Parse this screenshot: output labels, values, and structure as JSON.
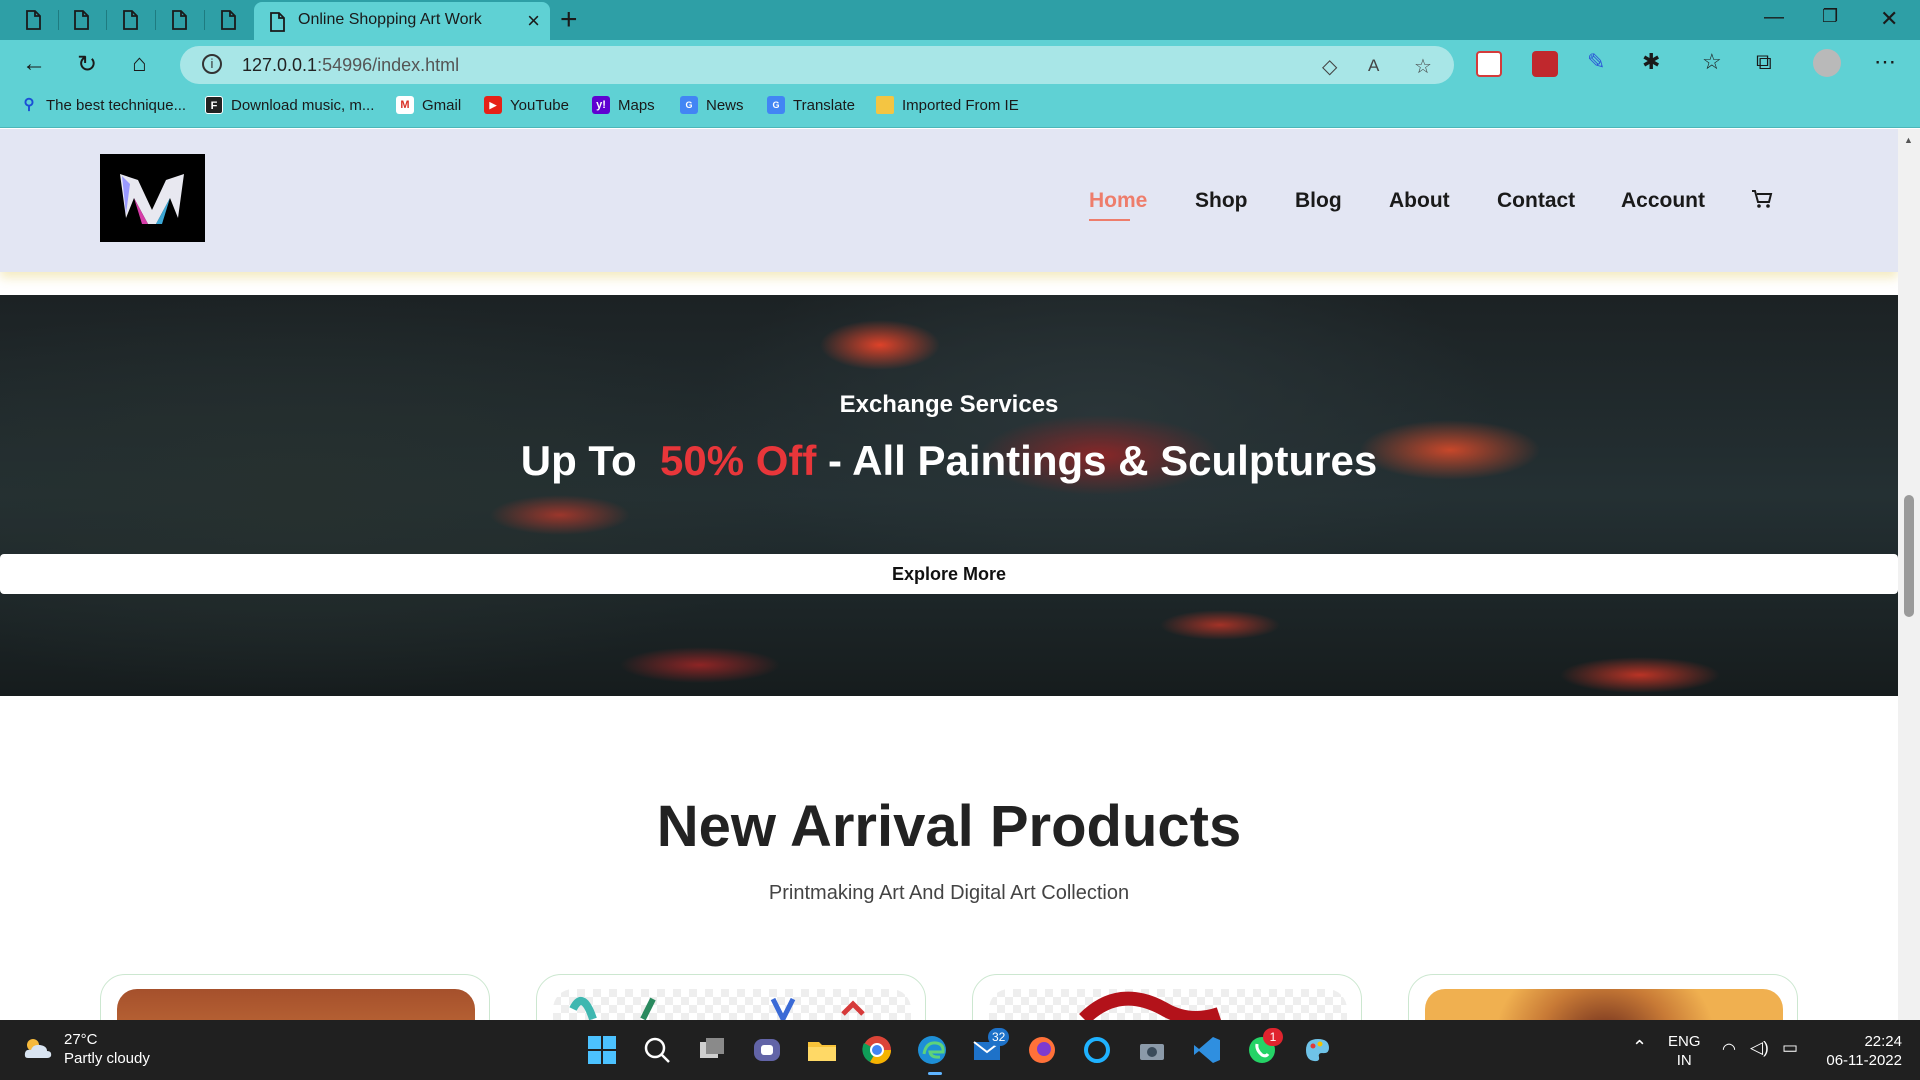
{
  "browser": {
    "active_tab_title": "Online Shopping Art Work",
    "url_host": "127.0.0.1",
    "url_rest": ":54996/index.html",
    "bookmarks": [
      {
        "label": "The best technique...",
        "icon": "search-icon"
      },
      {
        "label": "Download music, m...",
        "icon": "f-logo-icon"
      },
      {
        "label": "Gmail",
        "icon": "gmail-icon"
      },
      {
        "label": "YouTube",
        "icon": "youtube-icon"
      },
      {
        "label": "Maps",
        "icon": "yahoo-icon"
      },
      {
        "label": "News",
        "icon": "news-icon"
      },
      {
        "label": "Translate",
        "icon": "translate-icon"
      },
      {
        "label": "Imported From IE",
        "icon": "folder-icon"
      }
    ]
  },
  "site": {
    "nav": {
      "home": "Home",
      "shop": "Shop",
      "blog": "Blog",
      "about": "About",
      "contact": "Contact",
      "account": "Account"
    },
    "hero": {
      "subtitle": "Exchange Services",
      "title_prefix": "Up To",
      "title_highlight": "50% Off",
      "title_suffix": "- All Paintings & Sculptures",
      "button": "Explore More"
    },
    "section": {
      "title": "New Arrival Products",
      "subtitle": "Printmaking Art And Digital Art Collection"
    },
    "colors": {
      "accent": "#ee7d6b",
      "highlight": "#e8363a",
      "header_bg": "#e3e6f3"
    }
  },
  "taskbar": {
    "temperature": "27°C",
    "weather": "Partly cloudy",
    "mail_badge": "32",
    "whatsapp_badge": "1",
    "lang_top": "ENG",
    "lang_bottom": "IN",
    "time": "22:24",
    "date": "06-11-2022"
  }
}
